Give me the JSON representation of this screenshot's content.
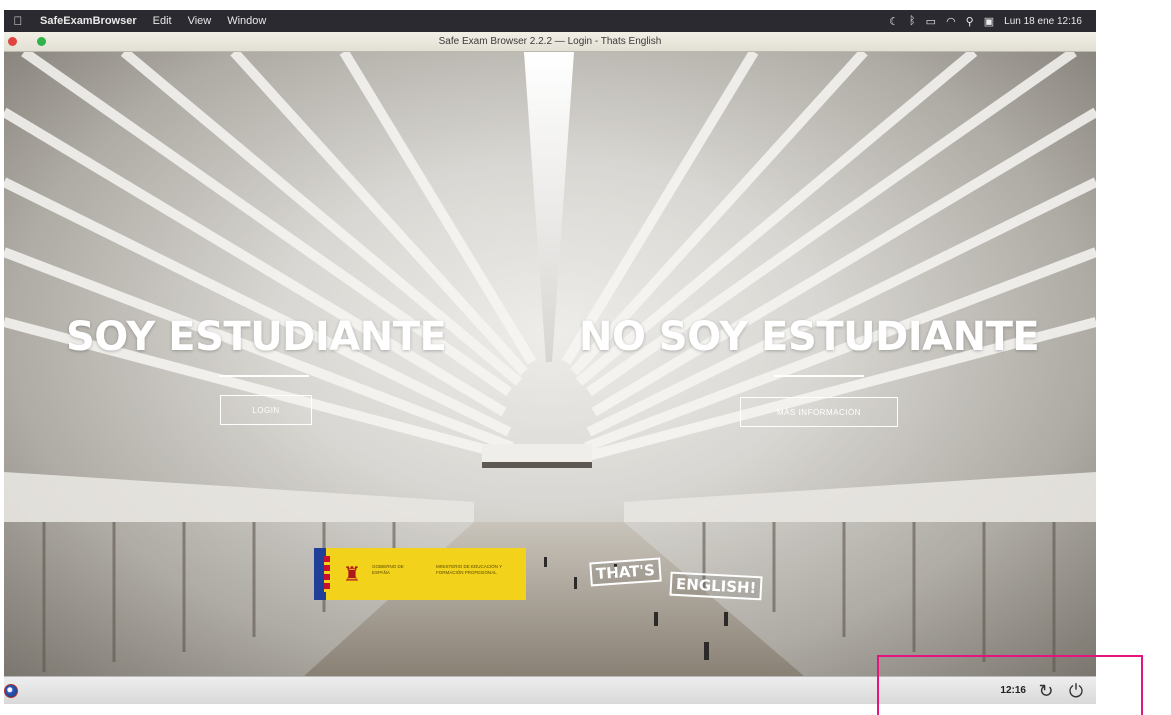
{
  "menubar": {
    "items": [
      "SafeExamBrowser",
      "Edit",
      "View",
      "Window"
    ],
    "clock": "Lun 18 ene 12:16",
    "status_icons": [
      "moon-icon",
      "bluetooth-icon",
      "battery-icon",
      "wifi-icon",
      "spotlight-search-icon",
      "display-icon"
    ]
  },
  "window": {
    "title": "Safe Exam Browser 2.2.2 — Login - Thats English"
  },
  "page": {
    "student": {
      "heading": "SOY ESTUDIANTE",
      "button": "LOGIN"
    },
    "non_student": {
      "heading": "NO SOY ESTUDIANTE",
      "button": "MÁS INFORMACIÓN"
    },
    "gov_logo": {
      "text1": "GOBIERNO DE ESPAÑA",
      "text2": "MINISTERIO DE EDUCACIÓN Y FORMACIÓN PROFESIONAL"
    },
    "brand_logo": {
      "word1": "THAT'S",
      "word2": "ENGLISH!"
    }
  },
  "taskbar": {
    "time": "12:16",
    "reload_icon": "reload-icon",
    "power_icon": "power-icon"
  },
  "colors": {
    "highlight": "#e5147f",
    "gov_yellow": "#f2d21b"
  }
}
